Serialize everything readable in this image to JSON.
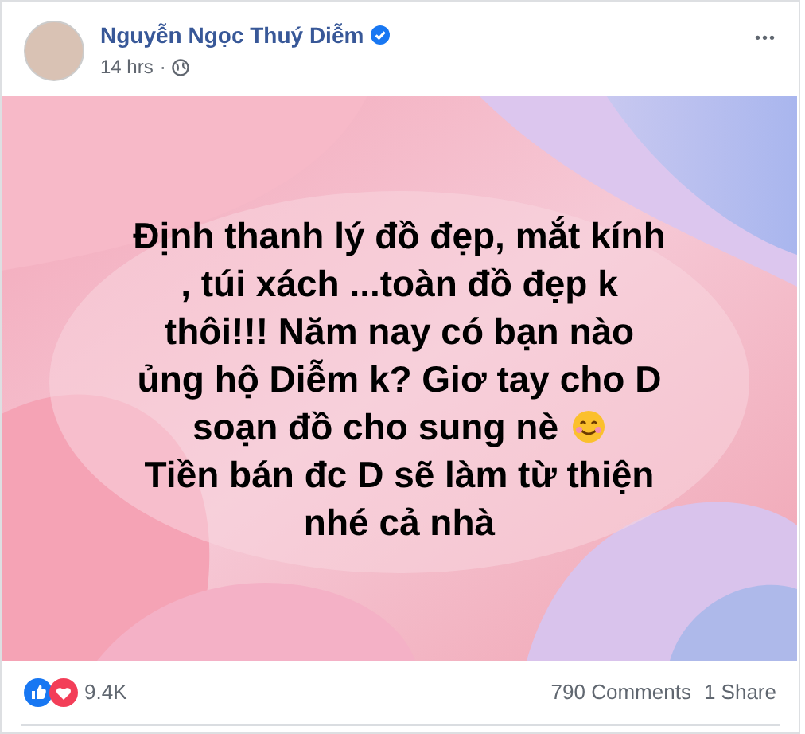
{
  "post": {
    "author": "Nguyễn Ngọc Thuý Diễm",
    "verified": true,
    "time": "14 hrs",
    "separator": "·",
    "menu": "•••",
    "lines": [
      "Định thanh lý đồ đẹp, mắt kính",
      ", túi xách ...toàn đồ đẹp k",
      "thôi!!! Năm nay có bạn nào",
      "ủng hộ Diễm k? Giơ tay cho D",
      "soạn đồ cho sung nè",
      "Tiền bán đc D sẽ làm từ thiện",
      "nhé cả nhà"
    ],
    "reactions_count": "9.4K",
    "comments": "790 Comments",
    "shares": "1 Share"
  }
}
